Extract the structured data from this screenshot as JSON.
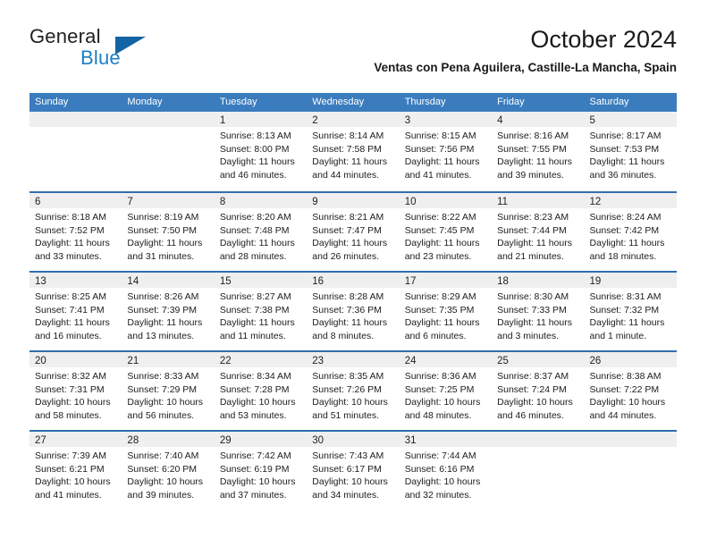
{
  "brand": {
    "name_top": "General",
    "name_bottom": "Blue",
    "color_dark": "#231f20",
    "color_blue": "#1b7fc4"
  },
  "header": {
    "title": "October 2024",
    "subtitle": "Ventas con Pena Aguilera, Castille-La Mancha, Spain"
  },
  "theme": {
    "header_bar": "#3a7cbe",
    "row_divider": "#2f6fae",
    "day_band": "#efefef"
  },
  "weekdays": [
    "Sunday",
    "Monday",
    "Tuesday",
    "Wednesday",
    "Thursday",
    "Friday",
    "Saturday"
  ],
  "weeks": [
    [
      {
        "day": "",
        "lines": []
      },
      {
        "day": "",
        "lines": []
      },
      {
        "day": "1",
        "lines": [
          "Sunrise: 8:13 AM",
          "Sunset: 8:00 PM",
          "Daylight: 11 hours",
          "and 46 minutes."
        ]
      },
      {
        "day": "2",
        "lines": [
          "Sunrise: 8:14 AM",
          "Sunset: 7:58 PM",
          "Daylight: 11 hours",
          "and 44 minutes."
        ]
      },
      {
        "day": "3",
        "lines": [
          "Sunrise: 8:15 AM",
          "Sunset: 7:56 PM",
          "Daylight: 11 hours",
          "and 41 minutes."
        ]
      },
      {
        "day": "4",
        "lines": [
          "Sunrise: 8:16 AM",
          "Sunset: 7:55 PM",
          "Daylight: 11 hours",
          "and 39 minutes."
        ]
      },
      {
        "day": "5",
        "lines": [
          "Sunrise: 8:17 AM",
          "Sunset: 7:53 PM",
          "Daylight: 11 hours",
          "and 36 minutes."
        ]
      }
    ],
    [
      {
        "day": "6",
        "lines": [
          "Sunrise: 8:18 AM",
          "Sunset: 7:52 PM",
          "Daylight: 11 hours",
          "and 33 minutes."
        ]
      },
      {
        "day": "7",
        "lines": [
          "Sunrise: 8:19 AM",
          "Sunset: 7:50 PM",
          "Daylight: 11 hours",
          "and 31 minutes."
        ]
      },
      {
        "day": "8",
        "lines": [
          "Sunrise: 8:20 AM",
          "Sunset: 7:48 PM",
          "Daylight: 11 hours",
          "and 28 minutes."
        ]
      },
      {
        "day": "9",
        "lines": [
          "Sunrise: 8:21 AM",
          "Sunset: 7:47 PM",
          "Daylight: 11 hours",
          "and 26 minutes."
        ]
      },
      {
        "day": "10",
        "lines": [
          "Sunrise: 8:22 AM",
          "Sunset: 7:45 PM",
          "Daylight: 11 hours",
          "and 23 minutes."
        ]
      },
      {
        "day": "11",
        "lines": [
          "Sunrise: 8:23 AM",
          "Sunset: 7:44 PM",
          "Daylight: 11 hours",
          "and 21 minutes."
        ]
      },
      {
        "day": "12",
        "lines": [
          "Sunrise: 8:24 AM",
          "Sunset: 7:42 PM",
          "Daylight: 11 hours",
          "and 18 minutes."
        ]
      }
    ],
    [
      {
        "day": "13",
        "lines": [
          "Sunrise: 8:25 AM",
          "Sunset: 7:41 PM",
          "Daylight: 11 hours",
          "and 16 minutes."
        ]
      },
      {
        "day": "14",
        "lines": [
          "Sunrise: 8:26 AM",
          "Sunset: 7:39 PM",
          "Daylight: 11 hours",
          "and 13 minutes."
        ]
      },
      {
        "day": "15",
        "lines": [
          "Sunrise: 8:27 AM",
          "Sunset: 7:38 PM",
          "Daylight: 11 hours",
          "and 11 minutes."
        ]
      },
      {
        "day": "16",
        "lines": [
          "Sunrise: 8:28 AM",
          "Sunset: 7:36 PM",
          "Daylight: 11 hours",
          "and 8 minutes."
        ]
      },
      {
        "day": "17",
        "lines": [
          "Sunrise: 8:29 AM",
          "Sunset: 7:35 PM",
          "Daylight: 11 hours",
          "and 6 minutes."
        ]
      },
      {
        "day": "18",
        "lines": [
          "Sunrise: 8:30 AM",
          "Sunset: 7:33 PM",
          "Daylight: 11 hours",
          "and 3 minutes."
        ]
      },
      {
        "day": "19",
        "lines": [
          "Sunrise: 8:31 AM",
          "Sunset: 7:32 PM",
          "Daylight: 11 hours",
          "and 1 minute."
        ]
      }
    ],
    [
      {
        "day": "20",
        "lines": [
          "Sunrise: 8:32 AM",
          "Sunset: 7:31 PM",
          "Daylight: 10 hours",
          "and 58 minutes."
        ]
      },
      {
        "day": "21",
        "lines": [
          "Sunrise: 8:33 AM",
          "Sunset: 7:29 PM",
          "Daylight: 10 hours",
          "and 56 minutes."
        ]
      },
      {
        "day": "22",
        "lines": [
          "Sunrise: 8:34 AM",
          "Sunset: 7:28 PM",
          "Daylight: 10 hours",
          "and 53 minutes."
        ]
      },
      {
        "day": "23",
        "lines": [
          "Sunrise: 8:35 AM",
          "Sunset: 7:26 PM",
          "Daylight: 10 hours",
          "and 51 minutes."
        ]
      },
      {
        "day": "24",
        "lines": [
          "Sunrise: 8:36 AM",
          "Sunset: 7:25 PM",
          "Daylight: 10 hours",
          "and 48 minutes."
        ]
      },
      {
        "day": "25",
        "lines": [
          "Sunrise: 8:37 AM",
          "Sunset: 7:24 PM",
          "Daylight: 10 hours",
          "and 46 minutes."
        ]
      },
      {
        "day": "26",
        "lines": [
          "Sunrise: 8:38 AM",
          "Sunset: 7:22 PM",
          "Daylight: 10 hours",
          "and 44 minutes."
        ]
      }
    ],
    [
      {
        "day": "27",
        "lines": [
          "Sunrise: 7:39 AM",
          "Sunset: 6:21 PM",
          "Daylight: 10 hours",
          "and 41 minutes."
        ]
      },
      {
        "day": "28",
        "lines": [
          "Sunrise: 7:40 AM",
          "Sunset: 6:20 PM",
          "Daylight: 10 hours",
          "and 39 minutes."
        ]
      },
      {
        "day": "29",
        "lines": [
          "Sunrise: 7:42 AM",
          "Sunset: 6:19 PM",
          "Daylight: 10 hours",
          "and 37 minutes."
        ]
      },
      {
        "day": "30",
        "lines": [
          "Sunrise: 7:43 AM",
          "Sunset: 6:17 PM",
          "Daylight: 10 hours",
          "and 34 minutes."
        ]
      },
      {
        "day": "31",
        "lines": [
          "Sunrise: 7:44 AM",
          "Sunset: 6:16 PM",
          "Daylight: 10 hours",
          "and 32 minutes."
        ]
      },
      {
        "day": "",
        "lines": []
      },
      {
        "day": "",
        "lines": []
      }
    ]
  ]
}
